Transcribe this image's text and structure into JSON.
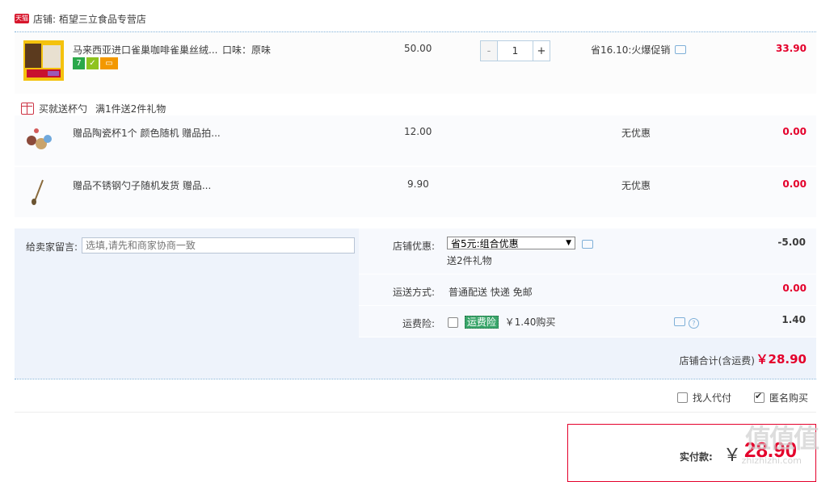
{
  "shop": {
    "badge": "天猫",
    "name": "店铺: 栢望三立食品专营店"
  },
  "main_item": {
    "title": "马来西亚进口雀巢咖啡雀巢丝绒...",
    "spec": "口味：原味",
    "price": "50.00",
    "quantity": "1",
    "promo": "省16.10:火爆促销",
    "subtotal": "33.90",
    "tag_icons": [
      "7",
      "✓",
      "▭"
    ]
  },
  "gift_header": {
    "label": "买就送杯勺",
    "rule": "满1件送2件礼物"
  },
  "gifts": [
    {
      "title": "赠品陶瓷杯1个 颜色随机 赠品拍...",
      "price": "12.00",
      "promo": "无优惠",
      "subtotal": "0.00",
      "icon": "cup-icon"
    },
    {
      "title": "赠品不锈钢勺子随机发货 赠品...",
      "price": "9.90",
      "promo": "无优惠",
      "subtotal": "0.00",
      "icon": "spoon-icon"
    }
  ],
  "message": {
    "label": "给卖家留言:",
    "placeholder": "选填,请先和商家协商一致"
  },
  "shop_discount": {
    "label": "店铺优惠:",
    "selected": "省5元:组合优惠",
    "note": "送2件礼物",
    "amount": "-5.00"
  },
  "shipping": {
    "label": "运送方式:",
    "value": "普通配送 快递 免邮",
    "amount": "0.00"
  },
  "insurance": {
    "label": "运费险:",
    "tag": "运费险",
    "price_text": "￥1.40购买",
    "amount": "1.40"
  },
  "shop_total": {
    "label": "店铺合计(含运费)",
    "amount": "￥28.90"
  },
  "options": {
    "proxy_pay": "找人代付",
    "anonymous": "匿名购买"
  },
  "payment": {
    "label": "实付款:",
    "currency": "￥",
    "amount": "28.90"
  },
  "watermark": {
    "text": "值值值",
    "sub": "zhizhizhi.com"
  },
  "colors": {
    "accent": "#e4002b",
    "border": "#7fb0d8",
    "tmall": "#d7162c"
  }
}
